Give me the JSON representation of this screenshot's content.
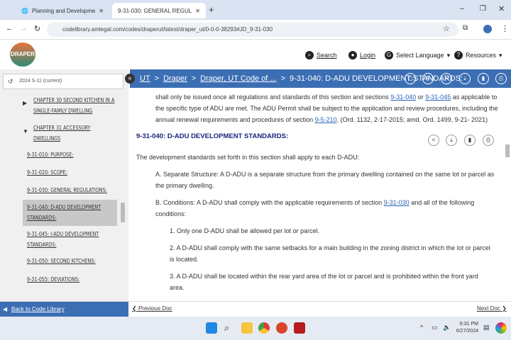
{
  "browser": {
    "tabs": [
      {
        "label": "Planning and Development | Cit"
      },
      {
        "label": "9-31-030: GENERAL REGULATI"
      }
    ],
    "url": "codelibrary.amlegal.com/codes/draperut/latest/draper_ut/0-0-0-38293#JD_9-31-030"
  },
  "header": {
    "logo": "DRAPER",
    "search": "Search",
    "login": "Login",
    "language": "Select Language",
    "resources": "Resources"
  },
  "sidebar": {
    "version": "2024 S-11 (current)",
    "items": [
      {
        "label": "CHAPTER 30 SECOND KITCHEN IN A SINGLE-FAMILY DWELLING"
      },
      {
        "label": "CHAPTER 31 ACCESSORY DWELLINGS"
      },
      {
        "label": "9-31-010: PURPOSE:"
      },
      {
        "label": "9-31-020: SCOPE:"
      },
      {
        "label": "9-31-030: GENERAL REGULATIONS:"
      },
      {
        "label": "9-31-040: D-ADU DEVELOPMENT STANDARDS:"
      },
      {
        "label": "9-31-045: I-ADU DEVELOPMENT STANDARDS:"
      },
      {
        "label": "9-31-050: SECOND KITCHENS:"
      },
      {
        "label": "9-31-055: DEVIATIONS:"
      }
    ],
    "back": "Back to Code Library"
  },
  "breadcrumb": {
    "items": [
      "UT",
      "Draper",
      "Draper, UT Code of ..."
    ],
    "current": "9-31-040: D-ADU DEVELOPMENT STANDARDS:"
  },
  "content": {
    "para1a": "shall only be issued once all regulations and standards of this section and sections ",
    "link1": "9-31-040",
    "or": " or ",
    "link2": "9-31-045",
    "para1b": " as applicable to",
    "para2": "the specific type of ADU are met. The ADU Permit shall be subject to the application and review procedures, including the",
    "para3a": "annual renewal requirements and procedures of section ",
    "link3": "9-5-210",
    "para3b": ". (Ord. 1132, 2-17-2015; amd. Ord. 1499, 9-21- 2021)",
    "heading": "9-31-040: D-ADU DEVELOPMENT STANDARDS:",
    "intro": "The development standards set forth in this section shall apply to each D-ADU:",
    "a1": "A.   Separate Structure: A D-ADU is a separate structure from the primary dwelling contained on the same lot or parcel as",
    "a2": "the primary dwelling.",
    "b1a": "B.   Conditions: A D-ADU shall comply with the applicable requirements of section ",
    "link4": "9-31-030",
    "b1b": " and all of the following",
    "b2": "conditions:",
    "c1": "1.   Only one D-ADU shall be allowed per lot or parcel.",
    "c2a": "2.   A D-ADU shall comply with the same setbacks for a main building in the zoning district in which the lot or parcel",
    "c2b": "is located.",
    "c3a": "3.   A D-ADU shall be located within the rear yard area of the lot or parcel and is prohibited within the front yard",
    "c3b": "area."
  },
  "nav": {
    "prev": "Previous Doc",
    "next": "Next Doc"
  },
  "taskbar": {
    "time": "6:31 PM",
    "date": "6/27/2024"
  },
  "colors": {
    "accent": "#3c6eb4",
    "heading": "#1a237e"
  }
}
